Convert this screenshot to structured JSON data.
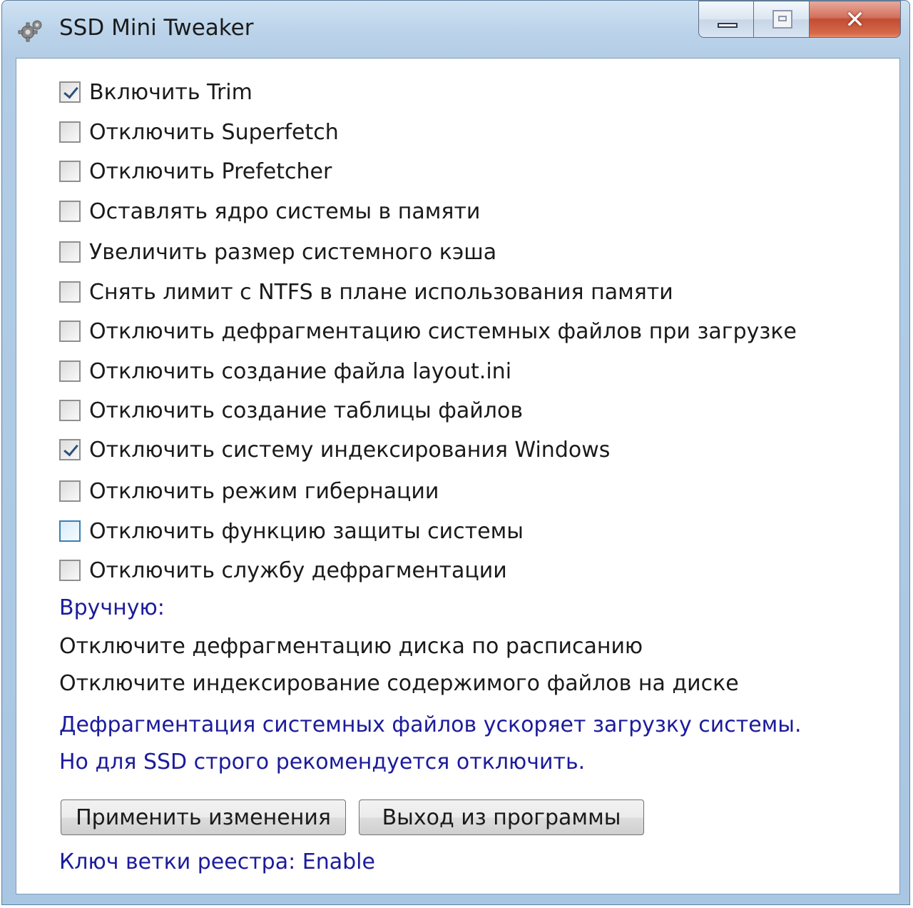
{
  "window": {
    "title": "SSD Mini Tweaker",
    "close_symbol": "✕"
  },
  "options": [
    {
      "label": "Включить Trim",
      "checked": true
    },
    {
      "label": "Отключить Superfetch",
      "checked": false
    },
    {
      "label": "Отключить Prefetcher",
      "checked": false
    },
    {
      "label": "Оставлять ядро системы в памяти",
      "checked": false
    },
    {
      "label": "Увеличить размер системного кэша",
      "checked": false
    },
    {
      "label": "Снять лимит с NTFS в плане использования памяти",
      "checked": false
    },
    {
      "label": "Отключить дефрагментацию системных файлов при загрузке",
      "checked": false
    },
    {
      "label": "Отключить создание файла layout.ini",
      "checked": false
    },
    {
      "label": "Отключить создание таблицы файлов",
      "checked": false
    },
    {
      "label": "Отключить систему индексирования Windows",
      "checked": true
    },
    {
      "label": "Отключить режим гибернации",
      "checked": false
    },
    {
      "label": "Отключить функцию защиты системы",
      "checked": false,
      "hover": true
    },
    {
      "label": "Отключить службу дефрагментации",
      "checked": false
    }
  ],
  "manual": {
    "heading": "Вручную:",
    "step1": "Отключите дефрагментацию диска по расписанию",
    "step2": "Отключите индексирование содержимого файлов на диске"
  },
  "hint": {
    "line1": "Дефрагментация системных файлов ускоряет загрузку системы.",
    "line2": "Но для SSD строго рекомендуется отключить."
  },
  "buttons": {
    "apply": "Применить изменения",
    "exit": "Выход из программы"
  },
  "status": "Ключ ветки реестра: Enable",
  "colors": {
    "info_text": "#1c1b9b",
    "checkmark": "#2c4f7c"
  },
  "icons": {
    "app": "gear-icon",
    "minimize": "minimize-icon",
    "maximize": "maximize-icon",
    "close": "close-icon"
  }
}
